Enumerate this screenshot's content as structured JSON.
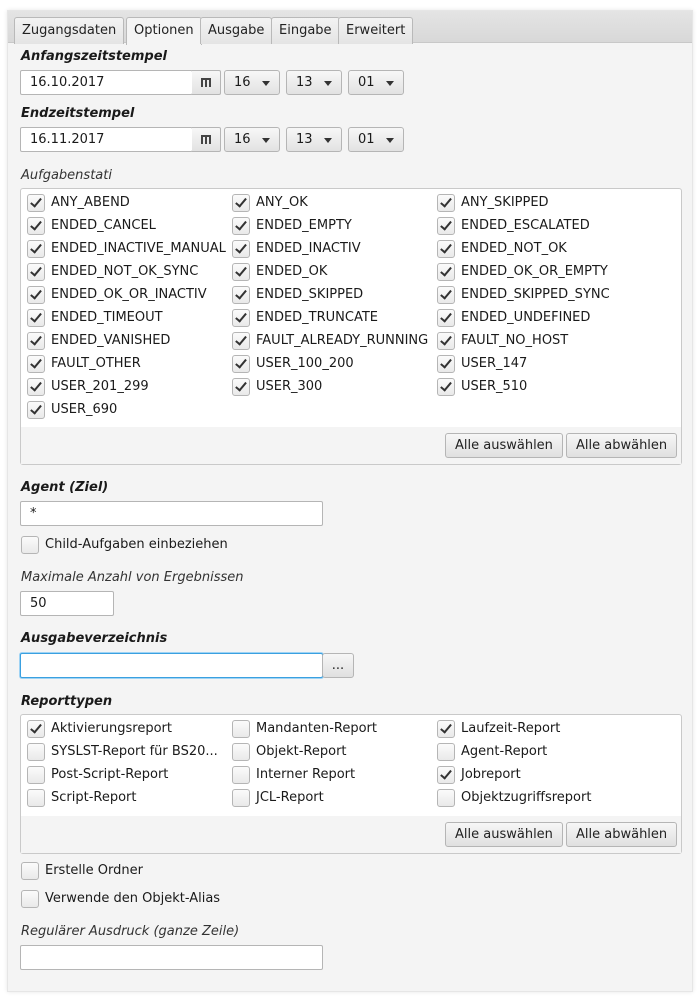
{
  "tabs": [
    {
      "label": "Zugangsdaten"
    },
    {
      "label": "Optionen"
    },
    {
      "label": "Ausgabe"
    },
    {
      "label": "Eingabe"
    },
    {
      "label": "Erweitert"
    }
  ],
  "active_tab": "Optionen",
  "start": {
    "label": "Anfangszeitstempel",
    "date": "16.10.2017",
    "hour": "16",
    "minute": "13",
    "second": "01"
  },
  "end": {
    "label": "Endzeitstempel",
    "date": "16.11.2017",
    "hour": "16",
    "minute": "13",
    "second": "01"
  },
  "task_status": {
    "label": "Aufgabenstati",
    "items": [
      {
        "label": "ANY_ABEND",
        "checked": true
      },
      {
        "label": "ANY_OK",
        "checked": true
      },
      {
        "label": "ANY_SKIPPED",
        "checked": true
      },
      {
        "label": "ENDED_CANCEL",
        "checked": true
      },
      {
        "label": "ENDED_EMPTY",
        "checked": true
      },
      {
        "label": "ENDED_ESCALATED",
        "checked": true
      },
      {
        "label": "ENDED_INACTIVE_MANUAL",
        "checked": true
      },
      {
        "label": "ENDED_INACTIV",
        "checked": true
      },
      {
        "label": "ENDED_NOT_OK",
        "checked": true
      },
      {
        "label": "ENDED_NOT_OK_SYNC",
        "checked": true
      },
      {
        "label": "ENDED_OK",
        "checked": true
      },
      {
        "label": "ENDED_OK_OR_EMPTY",
        "checked": true
      },
      {
        "label": "ENDED_OK_OR_INACTIV",
        "checked": true
      },
      {
        "label": "ENDED_SKIPPED",
        "checked": true
      },
      {
        "label": "ENDED_SKIPPED_SYNC",
        "checked": true
      },
      {
        "label": "ENDED_TIMEOUT",
        "checked": true
      },
      {
        "label": "ENDED_TRUNCATE",
        "checked": true
      },
      {
        "label": "ENDED_UNDEFINED",
        "checked": true
      },
      {
        "label": "ENDED_VANISHED",
        "checked": true
      },
      {
        "label": "FAULT_ALREADY_RUNNING",
        "checked": true
      },
      {
        "label": "FAULT_NO_HOST",
        "checked": true
      },
      {
        "label": "FAULT_OTHER",
        "checked": true
      },
      {
        "label": "USER_100_200",
        "checked": true
      },
      {
        "label": "USER_147",
        "checked": true
      },
      {
        "label": "USER_201_299",
        "checked": true
      },
      {
        "label": "USER_300",
        "checked": true
      },
      {
        "label": "USER_510",
        "checked": true
      },
      {
        "label": "USER_690",
        "checked": true
      }
    ],
    "select_all": "Alle auswählen",
    "deselect_all": "Alle abwählen"
  },
  "agent": {
    "label": "Agent (Ziel)",
    "value": "*"
  },
  "child_tasks": {
    "label": "Child-Aufgaben einbeziehen",
    "checked": false
  },
  "max_results": {
    "label": "Maximale Anzahl von Ergebnissen",
    "value": "50"
  },
  "output_dir": {
    "label": "Ausgabeverzeichnis",
    "value": "",
    "browse_label": "..."
  },
  "report_types": {
    "label": "Reporttypen",
    "items": [
      {
        "label": "Aktivierungsreport",
        "checked": true
      },
      {
        "label": "Mandanten-Report",
        "checked": false
      },
      {
        "label": "Laufzeit-Report",
        "checked": true
      },
      {
        "label": "SYSLST-Report für BS20...",
        "checked": false
      },
      {
        "label": "Objekt-Report",
        "checked": false
      },
      {
        "label": "Agent-Report",
        "checked": false
      },
      {
        "label": "Post-Script-Report",
        "checked": false
      },
      {
        "label": "Interner Report",
        "checked": false
      },
      {
        "label": "Jobreport",
        "checked": true
      },
      {
        "label": "Script-Report",
        "checked": false
      },
      {
        "label": "JCL-Report",
        "checked": false
      },
      {
        "label": "Objektzugriffsreport",
        "checked": false
      }
    ],
    "select_all": "Alle auswählen",
    "deselect_all": "Alle abwählen"
  },
  "create_folder": {
    "label": "Erstelle Ordner",
    "checked": false
  },
  "use_alias": {
    "label": "Verwende den Objekt-Alias",
    "checked": false
  },
  "regex": {
    "label": "Regulärer Ausdruck (ganze Zeile)",
    "value": ""
  }
}
